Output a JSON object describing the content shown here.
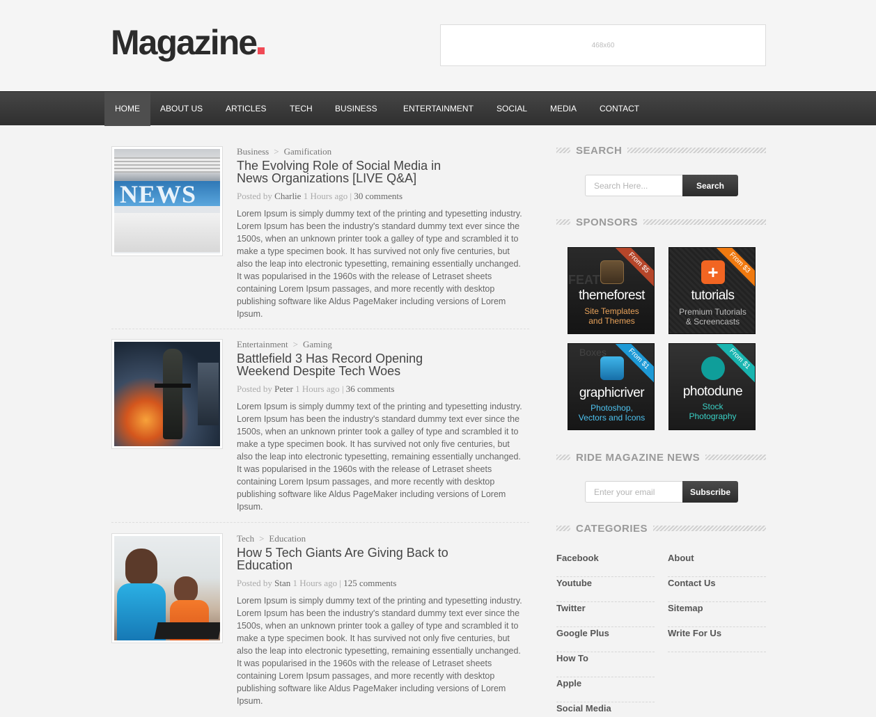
{
  "header": {
    "logo_text": "Magazine",
    "banner_text": "468x60"
  },
  "nav": {
    "items": [
      "HOME",
      "ABOUT US",
      "ARTICLES",
      "TECH",
      "BUSINESS",
      "ENTERTAINMENT",
      "SOCIAL",
      "MEDIA",
      "CONTACT"
    ],
    "active": "HOME"
  },
  "posts": [
    {
      "category": "Business",
      "separator": ">",
      "subcategory": "Gamification",
      "title": "The Evolving Role of Social Media in News Organizations [LIVE Q&A]",
      "posted_by_label": "Posted by",
      "author": "Charlie",
      "time": "1 Hours ago",
      "pipe": "|",
      "comments": "30 comments",
      "thumb_word": "NEWS",
      "excerpt": "Lorem Ipsum is simply dummy text of the printing and typesetting industry. Lorem Ipsum has been the industry's standard dummy text ever since the 1500s, when an unknown printer took a galley of type and scrambled it to make a type specimen book. It has survived not only five centuries, but also the leap into electronic typesetting, remaining essentially unchanged. It was popularised in the 1960s with the release of Letraset sheets containing Lorem Ipsum passages, and more recently with desktop publishing software like Aldus PageMaker including versions of Lorem Ipsum."
    },
    {
      "category": "Entertainment",
      "separator": ">",
      "subcategory": "Gaming",
      "title": "Battlefield 3 Has Record Opening Weekend Despite Tech Woes",
      "posted_by_label": "Posted by",
      "author": "Peter",
      "time": "1 Hours ago",
      "pipe": "|",
      "comments": "36 comments",
      "excerpt": "Lorem Ipsum is simply dummy text of the printing and typesetting industry. Lorem Ipsum has been the industry's standard dummy text ever since the 1500s, when an unknown printer took a galley of type and scrambled it to make a type specimen book. It has survived not only five centuries, but also the leap into electronic typesetting, remaining essentially unchanged. It was popularised in the 1960s with the release of Letraset sheets containing Lorem Ipsum passages, and more recently with desktop publishing software like Aldus PageMaker including versions of Lorem Ipsum."
    },
    {
      "category": "Tech",
      "separator": ">",
      "subcategory": "Education",
      "title": "How 5 Tech Giants Are Giving Back to Education",
      "posted_by_label": "Posted by",
      "author": "Stan",
      "time": "1 Hours ago",
      "pipe": "|",
      "comments": "125 comments",
      "excerpt": "Lorem Ipsum is simply dummy text of the printing and typesetting industry. Lorem Ipsum has been the industry's standard dummy text ever since the 1500s, when an unknown printer took a galley of type and scrambled it to make a type specimen book. It has survived not only five centuries, but also the leap into electronic typesetting, remaining essentially unchanged. It was popularised in the 1960s with the release of Letraset sheets containing Lorem Ipsum passages, and more recently with desktop publishing software like Aldus PageMaker including versions of Lorem Ipsum."
    }
  ],
  "sidebar": {
    "search": {
      "heading": "SEARCH",
      "placeholder": "Search Here...",
      "button": "Search"
    },
    "sponsors": {
      "heading": "SPONSORS",
      "items": [
        {
          "name": "themeforest",
          "tagline_1": "Site Templates",
          "tagline_2": "and Themes",
          "ribbon": "From $5",
          "ribbon_color": "#b5462a",
          "tag_color": "#e8a25a",
          "icon": "themeforest-icon",
          "bg_text": "FEATUR"
        },
        {
          "name": "tutorials",
          "tagline_1": "Premium Tutorials",
          "tagline_2": "& Screencasts",
          "ribbon": "From $3",
          "ribbon_color": "#f07a10",
          "tag_color": "#bdbdbd",
          "icon": "tutorials-plus-icon"
        },
        {
          "name": "graphicriver",
          "tagline_1": "Photoshop,",
          "tagline_2": "Vectors and Icons",
          "ribbon": "From $1",
          "ribbon_color": "#1e9ad6",
          "tag_color": "#4fc3f0",
          "icon": "graphicriver-icon",
          "bg_text": "Boxes"
        },
        {
          "name": "photodune",
          "tagline_1": "Stock",
          "tagline_2": "Photography",
          "ribbon": "From $1",
          "ribbon_color": "#19b5b0",
          "tag_color": "#3ad1c6",
          "icon": "photodune-icon"
        }
      ]
    },
    "newsletter": {
      "heading": "RIDE MAGAZINE NEWS",
      "placeholder": "Enter your email",
      "button": "Subscribe"
    },
    "categories": {
      "heading": "CATEGORIES",
      "left": [
        "Facebook",
        "Youtube",
        "Twitter",
        "Google Plus",
        "How To",
        "Apple",
        "Social Media"
      ],
      "right": [
        "About",
        "Contact Us",
        "Sitemap",
        "Write For Us"
      ]
    }
  },
  "colors": {
    "accent": "#f04a55",
    "nav_bg": "#3a3a3a"
  }
}
